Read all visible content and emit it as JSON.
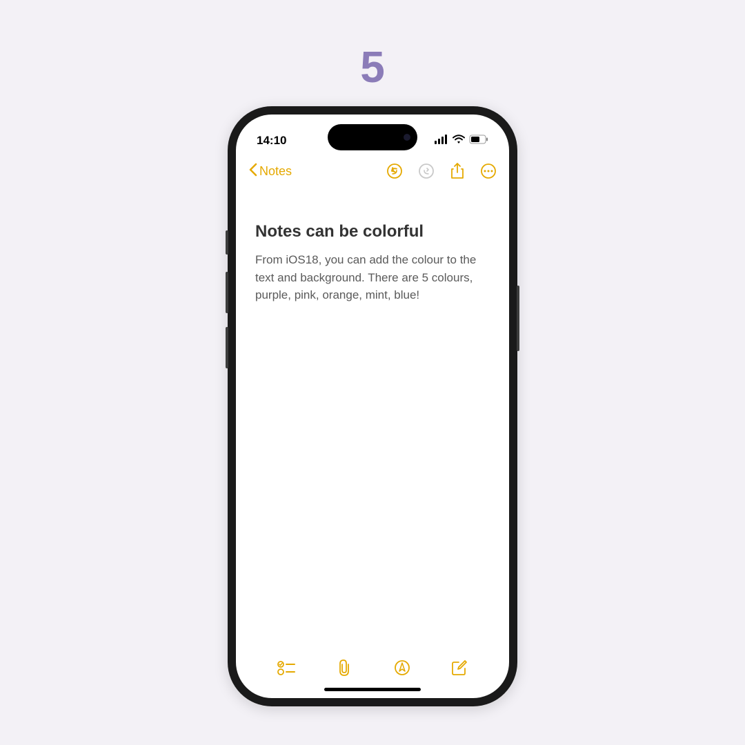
{
  "page": {
    "number": "5"
  },
  "statusBar": {
    "time": "14:10"
  },
  "navbar": {
    "backLabel": "Notes"
  },
  "note": {
    "title": "Notes can be colorful",
    "body": "From iOS18, you can add the colour to the text and background. There are 5 colours, purple, pink, orange, mint, blue!"
  },
  "colors": {
    "accent": "#e5a900",
    "disabled": "#c9c9c9"
  }
}
